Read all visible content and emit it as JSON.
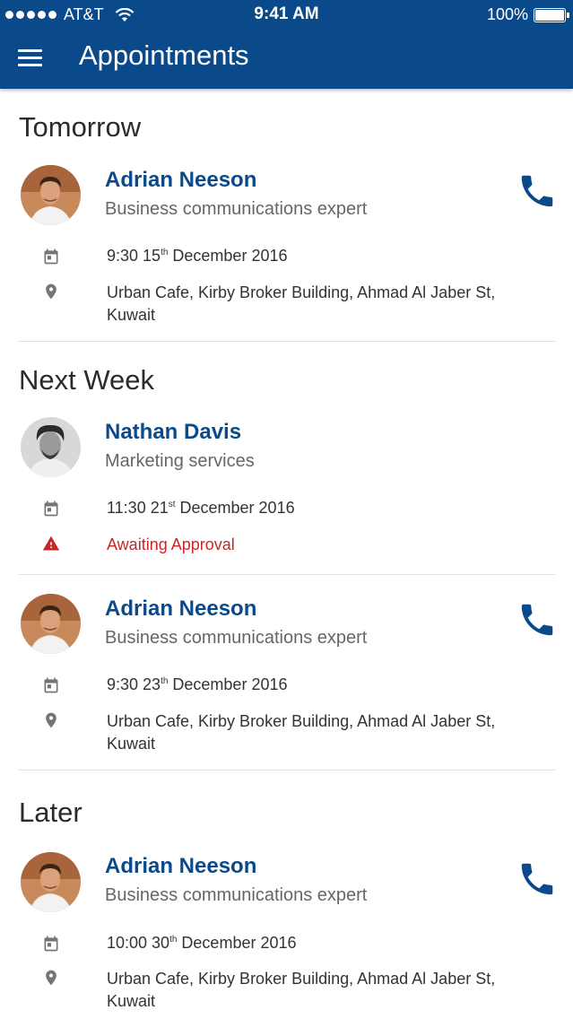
{
  "status_bar": {
    "carrier": "AT&T",
    "time": "9:41 AM",
    "battery": "100%"
  },
  "app_bar": {
    "title": "Appointments"
  },
  "sections": [
    {
      "title": "Tomorrow",
      "items": [
        {
          "name": "Adrian Neeson",
          "role": "Business communications expert",
          "time": "9:30 15",
          "date_suffix": "th",
          "date_rest": " December 2016",
          "location": "Urban Cafe, Kirby Broker Building, Ahmad Al Jaber St, Kuwait",
          "has_phone": true
        }
      ]
    },
    {
      "title": "Next Week",
      "items": [
        {
          "name": "Nathan Davis",
          "role": "Marketing services",
          "time": "11:30 21",
          "date_suffix": "st",
          "date_rest": " December 2016",
          "status": "Awaiting Approval",
          "has_phone": false
        },
        {
          "name": "Adrian Neeson",
          "role": "Business communications expert",
          "time": "9:30 23",
          "date_suffix": "th",
          "date_rest": " December 2016",
          "location": "Urban Cafe, Kirby Broker Building, Ahmad Al Jaber St, Kuwait",
          "has_phone": true
        }
      ]
    },
    {
      "title": "Later",
      "items": [
        {
          "name": "Adrian Neeson",
          "role": "Business communications expert",
          "time": "10:00 30",
          "date_suffix": "th",
          "date_rest": " December 2016",
          "location": "Urban Cafe, Kirby Broker Building, Ahmad Al Jaber St, Kuwait",
          "has_phone": true
        }
      ]
    }
  ],
  "icons": {
    "menu": "hamburger-menu-icon",
    "calendar": "calendar-icon",
    "location": "location-pin-icon",
    "warning": "warning-icon",
    "phone": "phone-icon"
  },
  "colors": {
    "primary": "#0b4a8a",
    "warning": "#c62828",
    "icon_grey": "#757575"
  }
}
